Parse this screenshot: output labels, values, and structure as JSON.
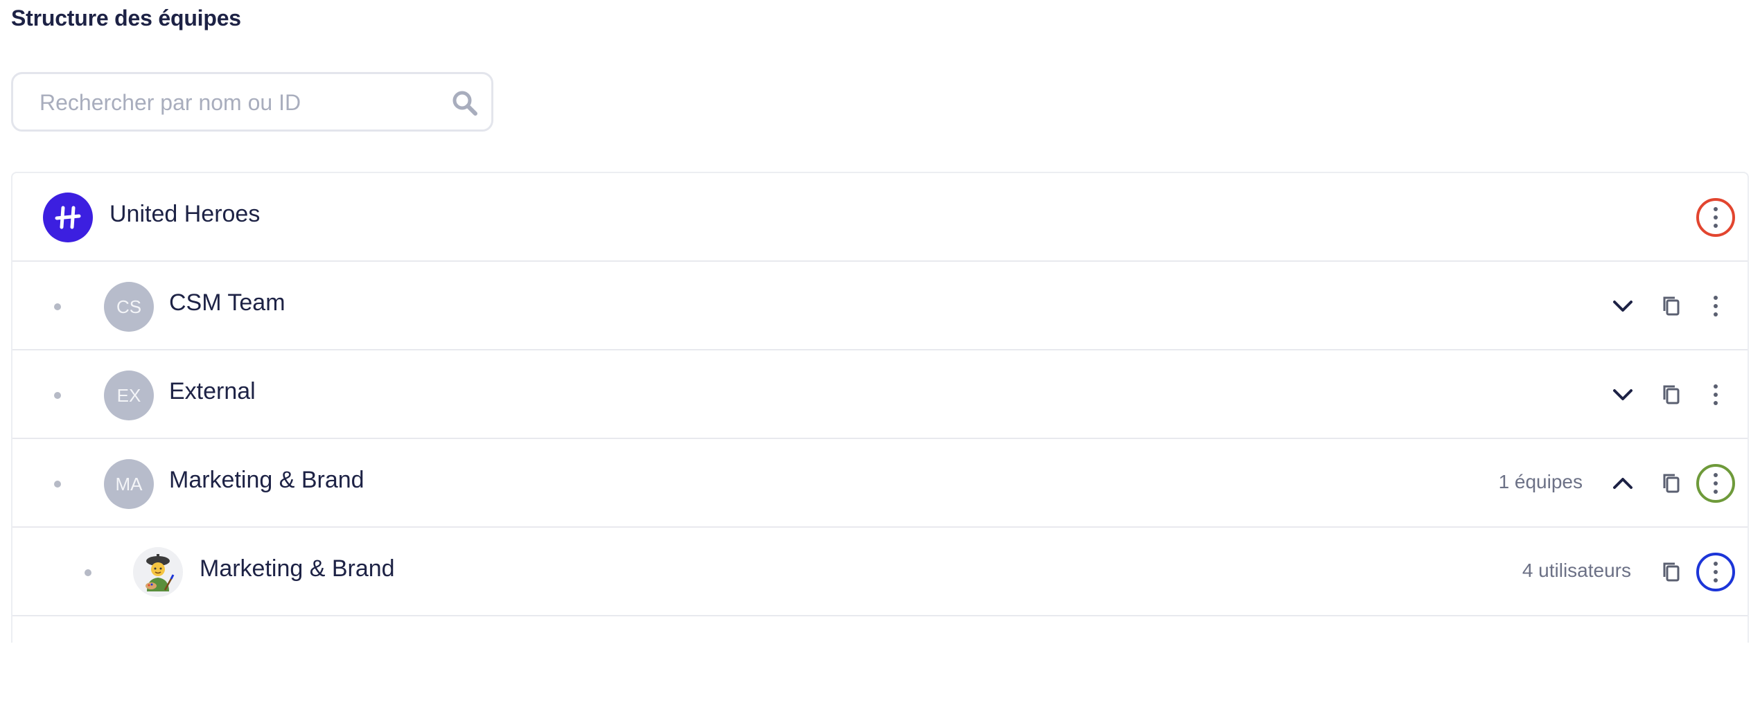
{
  "page": {
    "title": "Structure des équipes"
  },
  "search": {
    "placeholder": "Rechercher par nom ou ID",
    "icon": "search-icon"
  },
  "colors": {
    "brand": "#3c1fe0",
    "highlight_red": "#e2452f",
    "highlight_green": "#6e9a3a",
    "highlight_blue": "#1c35d8",
    "avatar_gray": "#b7bccb"
  },
  "tree": {
    "root": {
      "name": "United Heroes",
      "logo": "united-heroes-logo"
    },
    "teams": [
      {
        "initials": "CS",
        "name": "CSM Team",
        "count": "",
        "expanded": false
      },
      {
        "initials": "EX",
        "name": "External",
        "count": "",
        "expanded": false
      },
      {
        "initials": "MA",
        "name": "Marketing & Brand",
        "count": "1 équipes",
        "expanded": true
      }
    ],
    "subteam": {
      "name": "Marketing & Brand",
      "count": "4 utilisateurs",
      "avatar": "painter-emoji"
    }
  }
}
